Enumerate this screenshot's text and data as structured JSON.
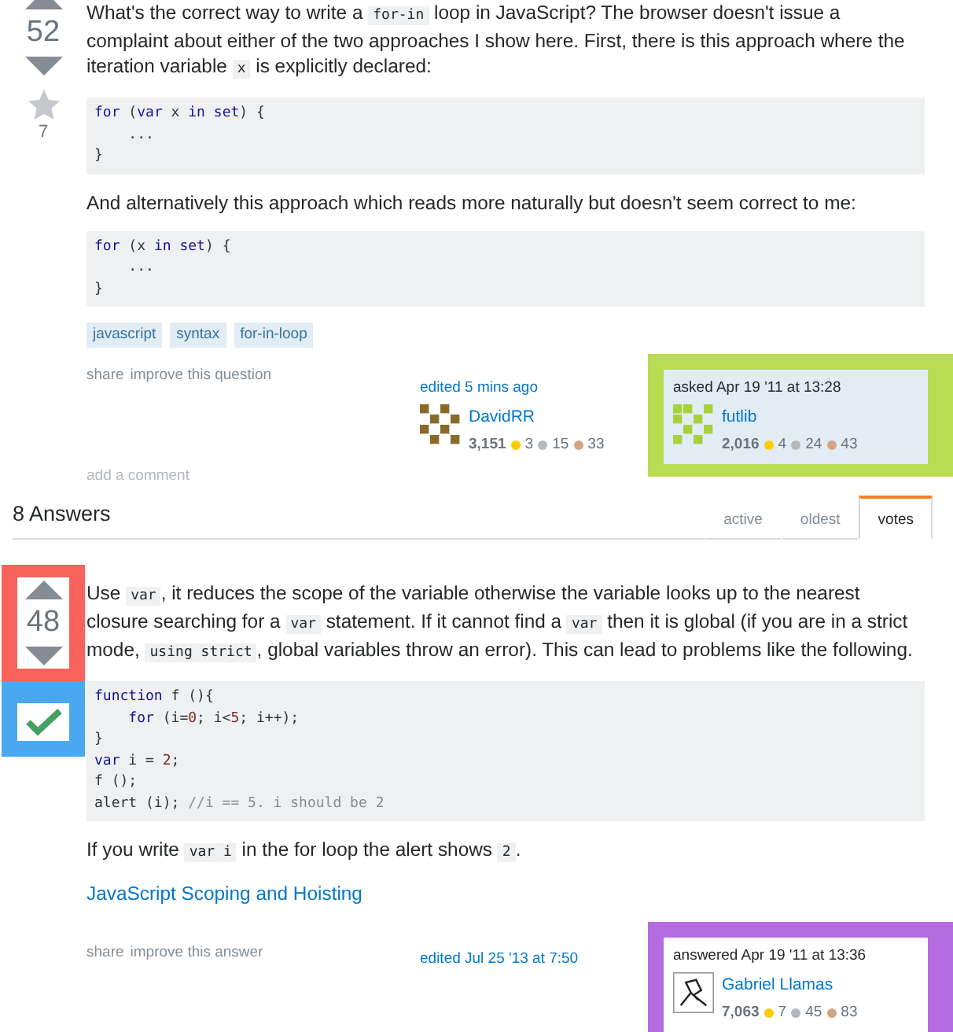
{
  "question": {
    "votes": "52",
    "favorites": "7",
    "paragraphs": [
      [
        {
          "kind": "text",
          "text": "What's the correct way to write a "
        },
        {
          "kind": "code",
          "text": "for-in"
        },
        {
          "kind": "text",
          "text": " loop in JavaScript? The browser doesn't issue a complaint about either of the two approaches I show here. First, there is this approach where the iteration variable "
        },
        {
          "kind": "code",
          "text": "x"
        },
        {
          "kind": "text",
          "text": " is explicitly declared:"
        }
      ],
      [
        {
          "kind": "codeblock",
          "lines": [
            [
              {
                "kind": "kw",
                "text": "for"
              },
              {
                "kind": "txt",
                "text": " ("
              },
              {
                "kind": "kw",
                "text": "var"
              },
              {
                "kind": "txt",
                "text": " x "
              },
              {
                "kind": "kw",
                "text": "in"
              },
              {
                "kind": "kw",
                "text": " set"
              },
              {
                "kind": "txt",
                "text": ") {"
              }
            ],
            [
              {
                "kind": "txt",
                "text": "    ..."
              }
            ],
            [
              {
                "kind": "txt",
                "text": "}"
              }
            ]
          ]
        }
      ],
      [
        {
          "kind": "text",
          "text": "And alternatively this approach which reads more naturally but doesn't seem correct to me:"
        }
      ],
      [
        {
          "kind": "codeblock",
          "lines": [
            [
              {
                "kind": "kw",
                "text": "for"
              },
              {
                "kind": "txt",
                "text": " (x "
              },
              {
                "kind": "kw",
                "text": "in"
              },
              {
                "kind": "kw",
                "text": " set"
              },
              {
                "kind": "txt",
                "text": ") {"
              }
            ],
            [
              {
                "kind": "txt",
                "text": "    ..."
              }
            ],
            [
              {
                "kind": "txt",
                "text": "}"
              }
            ]
          ]
        }
      ]
    ],
    "tags": [
      "javascript",
      "syntax",
      "for-in-loop"
    ],
    "menu": [
      "share",
      "improve this question"
    ],
    "editor": {
      "action": "edited 5 mins ago",
      "name": "DavidRR",
      "reputation": "3,151",
      "badges": [
        {
          "count": "3",
          "color": "#ffcc01"
        },
        {
          "count": "15",
          "color": "#b4b8bc"
        },
        {
          "count": "33",
          "color": "#d1a684"
        }
      ]
    },
    "owner": {
      "action": "asked Apr 19 '11 at 13:28",
      "name": "futlib",
      "reputation": "2,016",
      "color": "#b8dc52",
      "badges": [
        {
          "count": "4",
          "color": "#ffcc01"
        },
        {
          "count": "24",
          "color": "#b4b8bc"
        },
        {
          "count": "43",
          "color": "#d1a684"
        }
      ]
    },
    "add_comment": "add a comment"
  },
  "answers_header": {
    "title": "8 Answers",
    "tabs": [
      {
        "label": "active",
        "selected": false
      },
      {
        "label": "oldest",
        "selected": false
      },
      {
        "label": "votes",
        "selected": true
      }
    ]
  },
  "answer": {
    "votes": "48",
    "vote_frame": {
      "color": "#f8625a"
    },
    "accepted": true,
    "accept_frame": {
      "color": "#4aa8f0"
    },
    "paragraphs": [
      [
        {
          "kind": "text",
          "text": "Use "
        },
        {
          "kind": "code",
          "text": "var"
        },
        {
          "kind": "text",
          "text": ", it reduces the scope of the variable otherwise the variable looks up to the nearest closure searching for a "
        },
        {
          "kind": "code",
          "text": "var"
        },
        {
          "kind": "text",
          "text": " statement. If it cannot find a "
        },
        {
          "kind": "code",
          "text": "var"
        },
        {
          "kind": "text",
          "text": " then it is global (if you are in a strict mode, "
        },
        {
          "kind": "code",
          "text": "using strict"
        },
        {
          "kind": "text",
          "text": ", global variables throw an error). This can lead to problems like the following."
        }
      ],
      [
        {
          "kind": "codeblock",
          "lines": [
            [
              {
                "kind": "kw",
                "text": "function"
              },
              {
                "kind": "txt",
                "text": " f (){"
              }
            ],
            [
              {
                "kind": "kw",
                "text": "    for"
              },
              {
                "kind": "txt",
                "text": " (i="
              },
              {
                "kind": "num",
                "text": "0"
              },
              {
                "kind": "txt",
                "text": "; i<"
              },
              {
                "kind": "num",
                "text": "5"
              },
              {
                "kind": "txt",
                "text": "; i++);"
              }
            ],
            [
              {
                "kind": "txt",
                "text": "}"
              }
            ],
            [
              {
                "kind": "kw",
                "text": "var"
              },
              {
                "kind": "txt",
                "text": " i = "
              },
              {
                "kind": "num",
                "text": "2"
              },
              {
                "kind": "txt",
                "text": ";"
              }
            ],
            [
              {
                "kind": "txt",
                "text": "f ();"
              }
            ],
            [
              {
                "kind": "txt",
                "text": "alert (i); "
              },
              {
                "kind": "com",
                "text": "//i == 5. i should be 2"
              }
            ]
          ]
        }
      ],
      [
        {
          "kind": "text",
          "text": "If you write "
        },
        {
          "kind": "code",
          "text": "var i"
        },
        {
          "kind": "text",
          "text": " in the for loop the alert shows "
        },
        {
          "kind": "code",
          "text": "2"
        },
        {
          "kind": "text",
          "text": "."
        }
      ],
      [
        {
          "kind": "link",
          "text": "JavaScript Scoping and Hoisting"
        }
      ]
    ],
    "menu": [
      "share",
      "improve this answer"
    ],
    "editor": {
      "action": "edited Jul 25 '13 at 7:50"
    },
    "owner": {
      "action": "answered Apr 19 '11 at 13:36",
      "name": "Gabriel Llamas",
      "reputation": "7,063",
      "color": "#b56ce0",
      "badges": [
        {
          "count": "7",
          "color": "#ffcc01"
        },
        {
          "count": "45",
          "color": "#b4b8bc"
        },
        {
          "count": "83",
          "color": "#d1a684"
        }
      ]
    }
  }
}
